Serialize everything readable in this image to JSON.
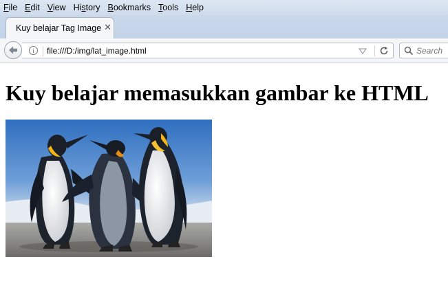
{
  "menu": {
    "items": [
      {
        "label": "File",
        "accel": "F",
        "rest": "ile"
      },
      {
        "label": "Edit",
        "accel": "E",
        "rest": "dit"
      },
      {
        "label": "View",
        "accel": "V",
        "rest": "iew"
      },
      {
        "label": "History",
        "pre": "Hi",
        "accel": "s",
        "rest": "tory"
      },
      {
        "label": "Bookmarks",
        "accel": "B",
        "rest": "ookmarks"
      },
      {
        "label": "Tools",
        "accel": "T",
        "rest": "ools"
      },
      {
        "label": "Help",
        "accel": "H",
        "rest": "elp"
      }
    ]
  },
  "tab": {
    "title": "Kuy belajar Tag Image",
    "close_glyph": "✕"
  },
  "navbar": {
    "url": "file:///D:/img/lat_image.html",
    "info_glyph": "i",
    "search_placeholder": "Search"
  },
  "page": {
    "heading": "Kuy belajar memasukkan gambar ke HTML",
    "image_subject": "penguins-photo"
  },
  "icons": {
    "back": "back-arrow-icon",
    "info": "info-icon",
    "dropdown": "dropdown-arrow-icon",
    "reload": "reload-icon",
    "search": "search-icon",
    "close": "close-icon"
  },
  "colors": {
    "menubar": "#d6e2ef",
    "tabstrip": "#c6d6e9",
    "toolbar": "#f5f6f7",
    "back_arrow": "#7c8794"
  }
}
